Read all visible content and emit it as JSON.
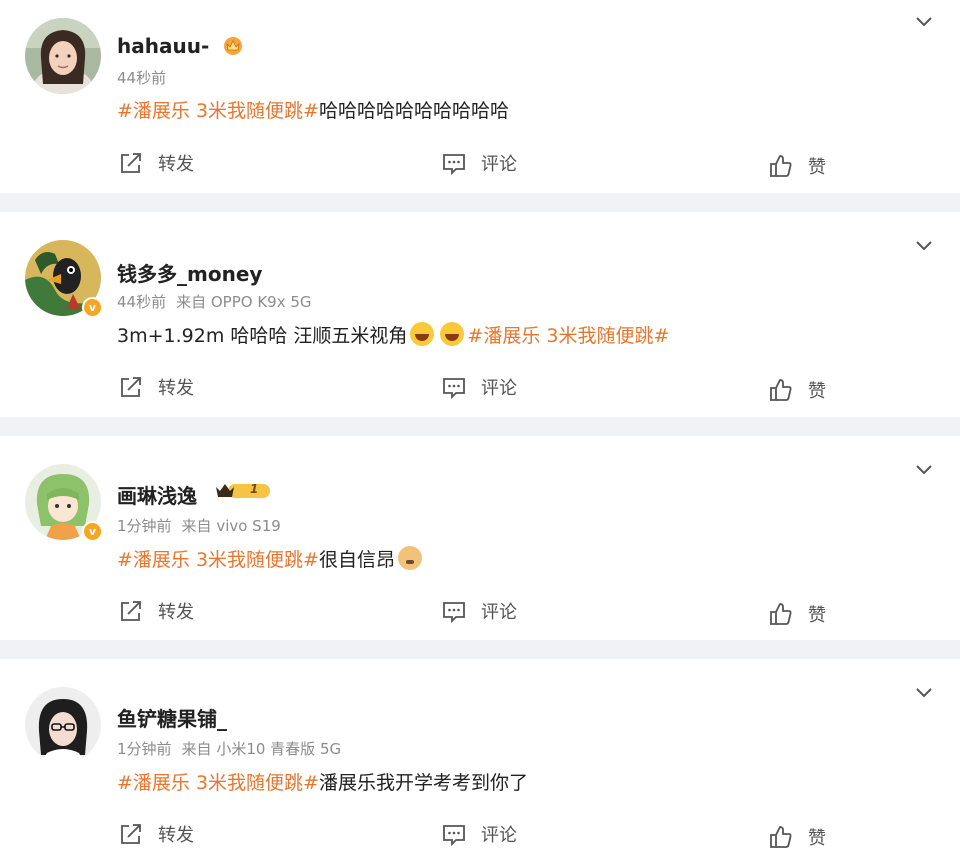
{
  "posts": [
    {
      "username": "hahauu-",
      "time": "44秒前",
      "source": "",
      "topic": "#潘展乐 3米我随便跳#",
      "text": "哈哈哈哈哈哈哈哈哈哈",
      "repost_label": "转发",
      "comment_label": "评论",
      "like_label": "赞"
    },
    {
      "username": "钱多多_money",
      "time": "44秒前",
      "source": "来自 OPPO K9x 5G",
      "text": "3m+1.92m 哈哈哈 汪顺五米视角",
      "topic": "#潘展乐 3米我随便跳#",
      "emoji": "laugh-cry-emoji",
      "repost_label": "转发",
      "comment_label": "评论",
      "like_label": "赞"
    },
    {
      "username": "画琳浅逸",
      "vip_level": "1",
      "time": "1分钟前",
      "source": "来自 vivo S19",
      "topic": "#潘展乐 3米我随便跳#",
      "text": "很自信昂",
      "emoji": "doge-emoji",
      "repost_label": "转发",
      "comment_label": "评论",
      "like_label": "赞"
    },
    {
      "username": "鱼铲糖果铺_",
      "time": "1分钟前",
      "source": "来自 小米10 青春版 5G",
      "topic": "#潘展乐 3米我随便跳#",
      "text": "潘展乐我开学考考到你了",
      "repost_label": "转发",
      "comment_label": "评论",
      "like_label": "赞"
    }
  ],
  "colors": {
    "topic": "#e8762f",
    "background": "#f1f2f5",
    "verified_badge": "#f5a623"
  },
  "icons": {
    "repost": "repost-icon",
    "comment": "comment-icon",
    "like": "like-icon",
    "menu": "chevron-down-icon"
  }
}
